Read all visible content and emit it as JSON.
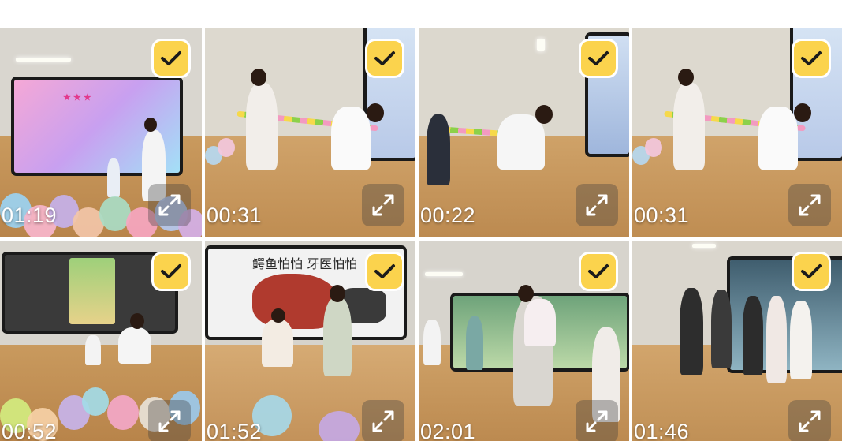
{
  "colors": {
    "check_badge": "#fbd34d",
    "check_border": "#ffffff",
    "duration_text": "#ffffff"
  },
  "icons": {
    "selected": "checkmark-icon",
    "enlarge": "expand-arrows-icon"
  },
  "videos": [
    {
      "duration": "01:19",
      "selected": true
    },
    {
      "duration": "00:31",
      "selected": true
    },
    {
      "duration": "00:22",
      "selected": true
    },
    {
      "duration": "00:31",
      "selected": true
    },
    {
      "duration": "00:52",
      "selected": true
    },
    {
      "duration": "01:52",
      "selected": true,
      "poster_text": "鳄鱼怕怕 牙医怕怕"
    },
    {
      "duration": "02:01",
      "selected": true
    },
    {
      "duration": "01:46",
      "selected": true
    }
  ]
}
